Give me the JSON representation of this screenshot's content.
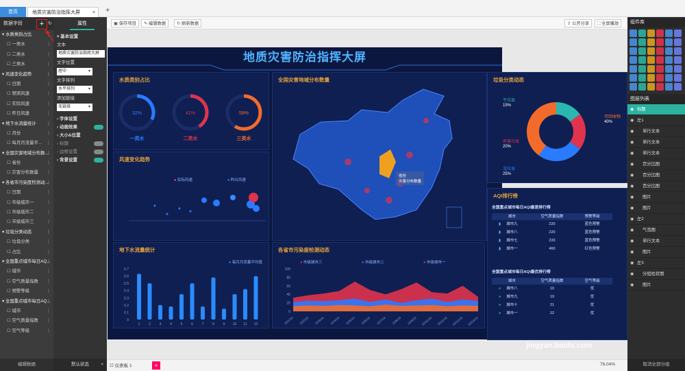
{
  "tabs": {
    "home": "首页",
    "screen": "地质灾害防治指挥大屏",
    "close": "×",
    "add": "+"
  },
  "fields": {
    "title": "数据字段",
    "plus": "+",
    "refresh": "↻",
    "items": [
      {
        "kind": "grp",
        "label": "水质类别占比"
      },
      {
        "kind": "sub",
        "label": "一类水"
      },
      {
        "kind": "sub",
        "label": "二类水"
      },
      {
        "kind": "sub",
        "label": "三类水"
      },
      {
        "kind": "grp",
        "label": "风速变化趋势"
      },
      {
        "kind": "sub",
        "label": "日期"
      },
      {
        "kind": "sub",
        "label": "预测风速"
      },
      {
        "kind": "sub",
        "label": "实际风速"
      },
      {
        "kind": "sub",
        "label": "昨日风速"
      },
      {
        "kind": "grp",
        "label": "地下水流量统计"
      },
      {
        "kind": "sub",
        "label": "月份"
      },
      {
        "kind": "sub",
        "label": "每月月流量平..."
      },
      {
        "kind": "grp",
        "label": "全国灾害地域分布数..."
      },
      {
        "kind": "sub",
        "label": "省份"
      },
      {
        "kind": "sub",
        "label": "灾害分布数量"
      },
      {
        "kind": "grp",
        "label": "各省市污染度检测动..."
      },
      {
        "kind": "sub",
        "label": "日期"
      },
      {
        "kind": "sub",
        "label": "市级城市一"
      },
      {
        "kind": "sub",
        "label": "市级城市二"
      },
      {
        "kind": "sub",
        "label": "市级城市三"
      },
      {
        "kind": "grp",
        "label": "垃圾分类动态"
      },
      {
        "kind": "sub",
        "label": "垃圾分类"
      },
      {
        "kind": "sub",
        "label": "占比"
      },
      {
        "kind": "grp",
        "label": "全国重点城市每日AQ..."
      },
      {
        "kind": "sub",
        "label": "城市"
      },
      {
        "kind": "sub",
        "label": "空气质量指数"
      },
      {
        "kind": "sub",
        "label": "预警等级"
      },
      {
        "kind": "grp",
        "label": "全国重点城市每日AQ..."
      },
      {
        "kind": "sub",
        "label": "城市"
      },
      {
        "kind": "sub",
        "label": "空气质量指数"
      },
      {
        "kind": "sub",
        "label": "空气等级"
      }
    ],
    "footer": "编辑数据"
  },
  "props": {
    "header": "属性",
    "basic": "基本设置",
    "text_label": "文本",
    "text_value": "地质灾害防治指挥大屏",
    "align_label": "文字位置",
    "align_value": "居中",
    "dir_label": "文字排列",
    "dir_value": "水平排列",
    "link_label": "添加链接",
    "link_value": "无链接",
    "font": "字体设置",
    "anim": "动画效果",
    "size": "大小&位置",
    "mark": "标题",
    "border": "边框设置",
    "bg": "背景设置",
    "footer": "默认状态",
    "footer_plus": "+"
  },
  "toolbar": {
    "save": "保存项目",
    "edit": "编辑数据",
    "refresh": "刷新数据",
    "share": "公开分享",
    "full": "全屏播放"
  },
  "screen": {
    "title": "地质灾害防治指挥大屏",
    "water": {
      "title": "水质类别占比",
      "rings": [
        {
          "pct": "32%",
          "name": "一类水",
          "color": "#2a7bff",
          "value": 32
        },
        {
          "pct": "41%",
          "name": "二类水",
          "color": "#e0334d",
          "value": 41
        },
        {
          "pct": "59%",
          "name": "三类水",
          "color": "#f36b2b",
          "value": 59
        }
      ]
    },
    "wind": {
      "title": "风速变化趋势",
      "legend": [
        "实际风速",
        "昨日风速"
      ]
    },
    "map": {
      "title": "全国灾害地域分布数量",
      "tip_prov": "省份",
      "tip_label": "灾害分布数量"
    },
    "flow": {
      "title": "地下水流量统计",
      "legend": "每月月流量平均值"
    },
    "pollution": {
      "title": "各省市污染度检测动态",
      "legend": [
        "市级城市三",
        "市级城市二",
        "市级城市一"
      ]
    },
    "garbage": {
      "title": "垃圾分类动态",
      "items": [
        {
          "name": "干垃圾",
          "pct": "15%"
        },
        {
          "name": "有害垃圾",
          "pct": "20%"
        },
        {
          "name": "湿垃圾",
          "pct": "25%"
        },
        {
          "name": "可回收物",
          "pct": "40%"
        }
      ]
    },
    "aqi": {
      "title": "AQI排行榜",
      "sub1": "全国重点城市每日AQI最差排行榜",
      "head1": [
        "城市",
        "空气质量指数",
        "预警等级"
      ],
      "rows1": [
        [
          "城市九",
          "220",
          "蓝色预警"
        ],
        [
          "城市八",
          "220",
          "蓝色预警"
        ],
        [
          "城市七",
          "220",
          "蓝色预警"
        ],
        [
          "城市一",
          "460",
          "红色预警"
        ]
      ],
      "sub2": "全国重点城市每日AQI最优排行榜",
      "head2": [
        "城市",
        "空气质量指数",
        "空气等级"
      ],
      "rows2": [
        [
          "城市八",
          "10",
          "优"
        ],
        [
          "城市九",
          "19",
          "优"
        ],
        [
          "城市十",
          "21",
          "优"
        ],
        [
          "城市一",
          "22",
          "优"
        ]
      ]
    }
  },
  "chart_data": [
    {
      "type": "bar",
      "title": "地下水流量统计",
      "categories": [
        "1",
        "2",
        "3",
        "4",
        "5",
        "6",
        "7",
        "8",
        "9",
        "10",
        "11",
        "12"
      ],
      "series": [
        {
          "name": "每月月流量平均值",
          "values": [
            0.63,
            0.5,
            0.2,
            0.18,
            0.35,
            0.5,
            0.18,
            0.58,
            0.15,
            0.35,
            0.42,
            0.6
          ]
        }
      ],
      "ylim": [
        0,
        0.7
      ],
      "yticks": [
        "0",
        "0.1",
        "0.2",
        "0.3",
        "0.4",
        "0.5",
        "0.6",
        "0.7"
      ]
    },
    {
      "type": "area",
      "title": "各省市污染度检测动态",
      "x": [
        "10/1/19",
        "10/2/19",
        "10/3/19",
        "10/4/19",
        "10/5/19",
        "10/6/19",
        "10/7/19",
        "10/8/19",
        "10/9/19",
        "10/10/19",
        "10/11/19",
        "10/12/19",
        "10/13/19"
      ],
      "series": [
        {
          "name": "市级城市一",
          "values": [
            32,
            38,
            42,
            48,
            70,
            50,
            40,
            52,
            68,
            45,
            42,
            60,
            34
          ]
        },
        {
          "name": "市级城市二",
          "values": [
            22,
            25,
            24,
            26,
            30,
            22,
            28,
            20,
            26,
            30,
            22,
            28,
            24
          ]
        },
        {
          "name": "市级城市三",
          "values": [
            12,
            14,
            13,
            15,
            14,
            12,
            16,
            13,
            14,
            15,
            12,
            14,
            13
          ]
        }
      ],
      "ylim": [
        0,
        100
      ],
      "yticks": [
        "0",
        "20",
        "40",
        "60",
        "80",
        "100"
      ]
    },
    {
      "type": "pie",
      "title": "垃圾分类动态",
      "categories": [
        "干垃圾",
        "有害垃圾",
        "湿垃圾",
        "可回收物"
      ],
      "values": [
        15,
        20,
        25,
        40
      ]
    }
  ],
  "status": {
    "dash": "仪表板 1",
    "add": "+",
    "zoom": "76.04%"
  },
  "widgets": {
    "title": "组件库",
    "layers": "图层列表",
    "layer_items": [
      {
        "l": "标题",
        "sel": true
      },
      {
        "l": "左1",
        "g": true
      },
      {
        "l": "单行文本"
      },
      {
        "l": "单行文本"
      },
      {
        "l": "单行文本"
      },
      {
        "l": "百分比图"
      },
      {
        "l": "百分比图"
      },
      {
        "l": "百分比图"
      },
      {
        "l": "图片"
      },
      {
        "l": "图片"
      },
      {
        "l": "左2",
        "g": true
      },
      {
        "l": "气泡图"
      },
      {
        "l": "单行文本"
      },
      {
        "l": "图片"
      },
      {
        "l": "左3",
        "g": true
      },
      {
        "l": "分组柱状图"
      },
      {
        "l": "图片"
      }
    ],
    "footer": "取消全部分组"
  },
  "watermark": "jingyan.baidu.com"
}
